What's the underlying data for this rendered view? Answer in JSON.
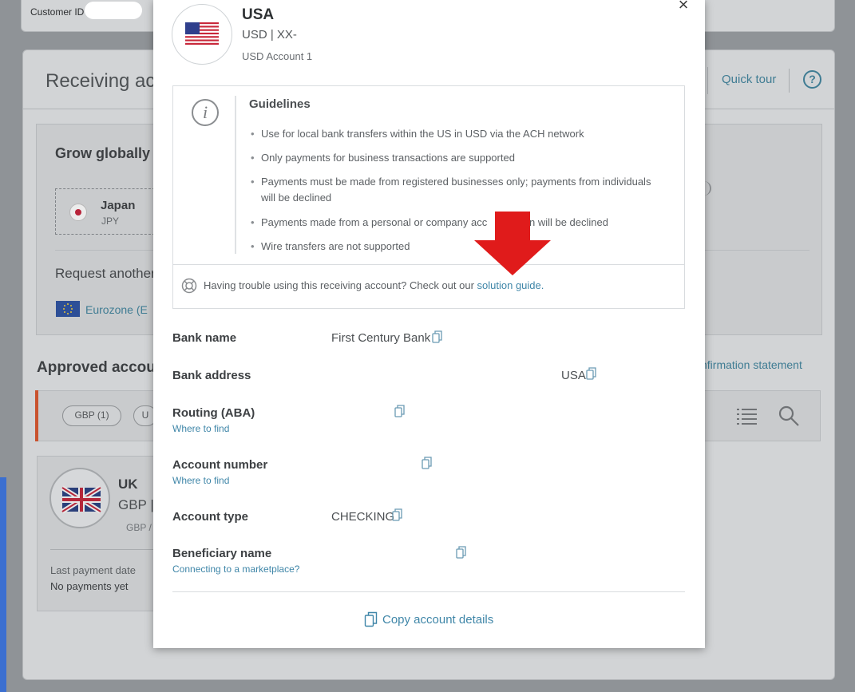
{
  "background": {
    "customer_label": "Customer ID",
    "receiving_title": "Receiving ac",
    "quick_tour": "Quick tour",
    "help": "?",
    "grow_title": "Grow globally –",
    "japan": {
      "name": "Japan",
      "code": "JPY"
    },
    "request_text": "Request another",
    "eurozone": "Eurozone (E",
    "approved_title": "Approved accour",
    "confirmation_link": "nfirmation statement",
    "chips": [
      "GBP (1)",
      "U"
    ],
    "uk": {
      "name": "UK",
      "code": "GBP |",
      "sub": "GBP /"
    },
    "last_payment_label": "Last payment date",
    "last_payment_value": "No payments yet"
  },
  "modal": {
    "close": "×",
    "country": "USA",
    "currency": "USD | XX-",
    "account_name": "USD Account 1",
    "guidelines": {
      "info_glyph": "i",
      "title": "Guidelines",
      "items": [
        "Use for local bank transfers within the US in USD via the ACH network",
        "Only payments for business transactions are supported",
        "Payments must be made from registered businesses only; payments from individuals will be declined",
        "Payments made from a personal or company acc          own will be declined",
        "Wire transfers are not supported"
      ],
      "trouble_text": "Having trouble using this receiving account? Check out our ",
      "solution_link": "solution guide",
      "trouble_end": "."
    },
    "fields": {
      "bank_name": {
        "label": "Bank name",
        "value": "First Century Bank"
      },
      "bank_address": {
        "label": "Bank address",
        "value": "USA"
      },
      "routing": {
        "label": "Routing (ABA)",
        "link": "Where to find"
      },
      "account_number": {
        "label": "Account number",
        "link": "Where to find"
      },
      "account_type": {
        "label": "Account type",
        "value": "CHECKING"
      },
      "beneficiary": {
        "label": "Beneficiary name",
        "link": "Connecting to a marketplace?"
      }
    },
    "copy_details": "Copy account details"
  },
  "colors": {
    "accent_link": "#3f86a8",
    "arrow": "#e01b1b",
    "filter_accent": "#c9522e"
  }
}
